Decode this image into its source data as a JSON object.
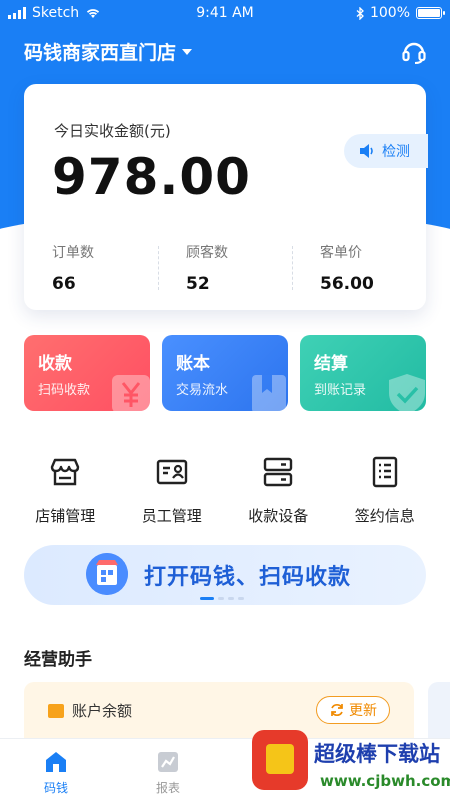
{
  "status_bar": {
    "carrier": "Sketch",
    "time": "9:41 AM",
    "battery": "100%"
  },
  "header": {
    "store_name": "码钱商家西直门店"
  },
  "revenue": {
    "label": "今日实收金额(元)",
    "amount": "978.00",
    "detect_label": "检测",
    "stats": [
      {
        "label": "订单数",
        "value": "66"
      },
      {
        "label": "顾客数",
        "value": "52"
      },
      {
        "label": "客单价",
        "value": "56.00"
      }
    ]
  },
  "tiles": [
    {
      "title": "收款",
      "subtitle": "扫码收款",
      "color": "#ff5a68"
    },
    {
      "title": "账本",
      "subtitle": "交易流水",
      "color": "#3a82f7"
    },
    {
      "title": "结算",
      "subtitle": "到账记录",
      "color": "#2cc4aa"
    }
  ],
  "grid": [
    {
      "label": "店铺管理",
      "icon": "store-icon"
    },
    {
      "label": "员工管理",
      "icon": "id-card-icon"
    },
    {
      "label": "收款设备",
      "icon": "device-icon"
    },
    {
      "label": "签约信息",
      "icon": "document-list-icon"
    }
  ],
  "banner": {
    "text": "打开码钱、扫码收款"
  },
  "assistant": {
    "title": "经营助手",
    "balance_label": "账户余额",
    "refresh_label": "更新"
  },
  "tabbar": [
    {
      "label": "码钱",
      "active": true
    },
    {
      "label": "报表",
      "active": false
    }
  ],
  "watermark": {
    "title": "超级棒下载站",
    "url": "www.cjbwh.com"
  },
  "colors": {
    "primary": "#1a7ff5",
    "orange": "#f08a00"
  }
}
